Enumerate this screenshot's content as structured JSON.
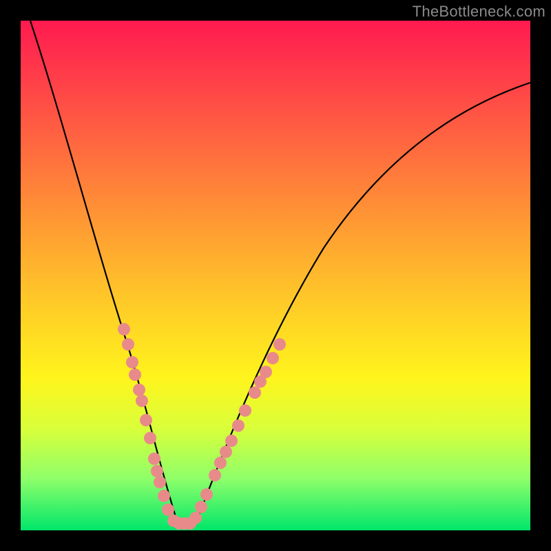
{
  "watermark": "TheBottleneck.com",
  "chart_data": {
    "type": "line",
    "title": "",
    "xlabel": "",
    "ylabel": "",
    "xlim": [
      0,
      100
    ],
    "ylim": [
      0,
      100
    ],
    "grid": false,
    "legend": false,
    "series": [
      {
        "name": "bottleneck-curve",
        "x": [
          2,
          5,
          10,
          14,
          18,
          21,
          24,
          26,
          28,
          30,
          32,
          34,
          36,
          40,
          46,
          54,
          62,
          70,
          78,
          86,
          94,
          100
        ],
        "y": [
          100,
          90,
          74,
          60,
          47,
          36,
          26,
          18,
          11,
          4,
          0,
          0,
          3,
          10,
          22,
          36,
          49,
          59,
          68,
          75,
          80,
          83
        ]
      }
    ],
    "annotations": {
      "scatter_points": [
        {
          "x": 20,
          "y": 40
        },
        {
          "x": 21,
          "y": 36
        },
        {
          "x": 22,
          "y": 32
        },
        {
          "x": 22.5,
          "y": 30
        },
        {
          "x": 23.5,
          "y": 27
        },
        {
          "x": 24,
          "y": 25
        },
        {
          "x": 25,
          "y": 20
        },
        {
          "x": 26,
          "y": 16
        },
        {
          "x": 27,
          "y": 12
        },
        {
          "x": 27.5,
          "y": 10
        },
        {
          "x": 28,
          "y": 8
        },
        {
          "x": 29,
          "y": 5
        },
        {
          "x": 30,
          "y": 2
        },
        {
          "x": 31,
          "y": 0
        },
        {
          "x": 32,
          "y": 0
        },
        {
          "x": 33,
          "y": 0
        },
        {
          "x": 34,
          "y": 0
        },
        {
          "x": 35,
          "y": 2
        },
        {
          "x": 36,
          "y": 4
        },
        {
          "x": 37,
          "y": 6
        },
        {
          "x": 39,
          "y": 10
        },
        {
          "x": 40,
          "y": 12
        },
        {
          "x": 41,
          "y": 14
        },
        {
          "x": 42,
          "y": 16
        },
        {
          "x": 43.5,
          "y": 19
        },
        {
          "x": 45,
          "y": 22
        },
        {
          "x": 47,
          "y": 26
        },
        {
          "x": 48,
          "y": 28
        },
        {
          "x": 49,
          "y": 30
        },
        {
          "x": 50.5,
          "y": 33
        },
        {
          "x": 52,
          "y": 36
        }
      ]
    },
    "gradient_stops": [
      {
        "pos": 0,
        "color": "#ff1a4f"
      },
      {
        "pos": 25,
        "color": "#ff6a3f"
      },
      {
        "pos": 55,
        "color": "#ffc928"
      },
      {
        "pos": 80,
        "color": "#d9ff3a"
      },
      {
        "pos": 100,
        "color": "#00e66a"
      }
    ]
  }
}
